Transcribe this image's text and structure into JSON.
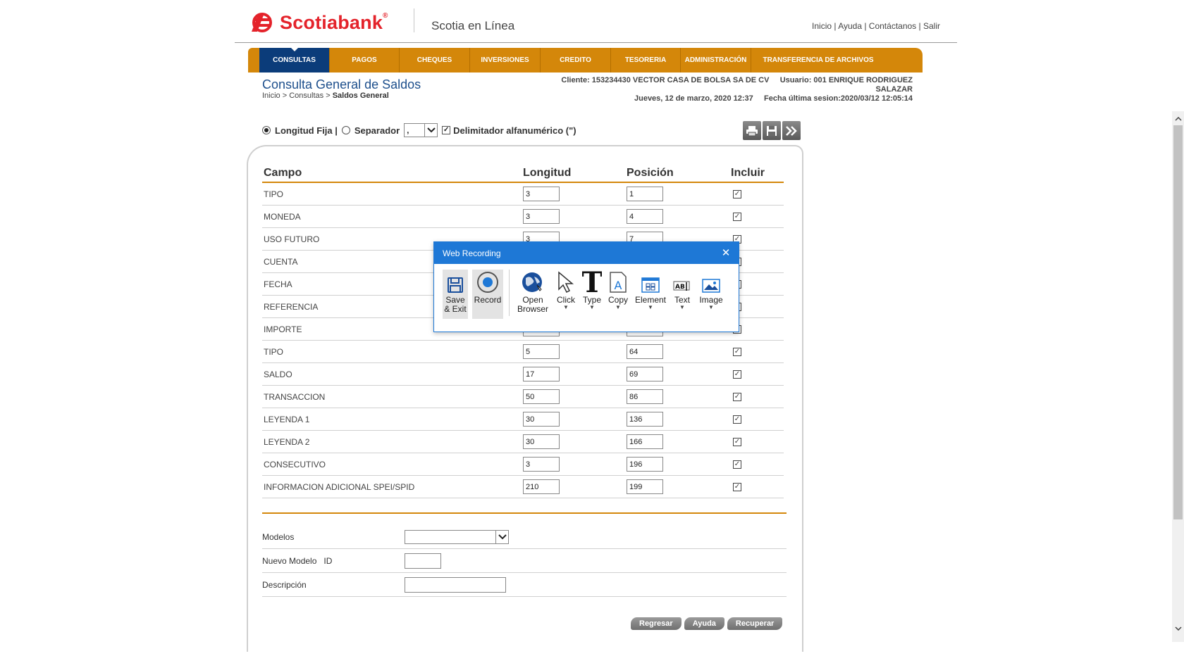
{
  "header": {
    "logo_text": "Scotiabank",
    "product": "Scotia en Línea",
    "links": [
      "Inicio",
      "Ayuda",
      "Contáctanos",
      "Salir"
    ]
  },
  "nav": [
    {
      "label": "CONSULTAS",
      "active": true
    },
    {
      "label": "PAGOS"
    },
    {
      "label": "CHEQUES"
    },
    {
      "label": "INVERSIONES"
    },
    {
      "label": "CREDITO"
    },
    {
      "label": "TESORERIA"
    },
    {
      "label": "ADMINISTRACIÓN"
    },
    {
      "label": "TRANSFERENCIA DE ARCHIVOS"
    }
  ],
  "page": {
    "title": "Consulta General de Saldos",
    "breadcrumb_1": "Inicio",
    "breadcrumb_2": "Consultas",
    "breadcrumb_current": "Saldos General",
    "client": "Cliente: 153234430 VECTOR CASA DE BOLSA SA DE CV",
    "user": "Usuario: 001 ENRIQUE RODRIGUEZ",
    "user_line2": "SALAZAR",
    "date": "Jueves, 12 de marzo, 2020 12:37",
    "last_session": "Fecha última sesion:2020/03/12 12:05:14"
  },
  "options": {
    "fixed_length": "Longitud Fija |",
    "separator": "Separador",
    "separator_value": ",",
    "delimiter": "Delimitador alfanumérico (\")"
  },
  "table": {
    "headers": [
      "Campo",
      "Longitud",
      "Posición",
      "Incluir"
    ],
    "rows": [
      {
        "campo": "TIPO",
        "longitud": "3",
        "posicion": "1"
      },
      {
        "campo": "MONEDA",
        "longitud": "3",
        "posicion": "4"
      },
      {
        "campo": "USO FUTURO",
        "longitud": "3",
        "posicion": "7"
      },
      {
        "campo": "CUENTA",
        "longitud": "",
        "posicion": ""
      },
      {
        "campo": "FECHA",
        "longitud": "",
        "posicion": ""
      },
      {
        "campo": "REFERENCIA",
        "longitud": "",
        "posicion": ""
      },
      {
        "campo": "IMPORTE",
        "longitud": "",
        "posicion": ""
      },
      {
        "campo": "TIPO",
        "longitud": "5",
        "posicion": "64"
      },
      {
        "campo": "SALDO",
        "longitud": "17",
        "posicion": "69"
      },
      {
        "campo": "TRANSACCION",
        "longitud": "50",
        "posicion": "86"
      },
      {
        "campo": "LEYENDA 1",
        "longitud": "30",
        "posicion": "136"
      },
      {
        "campo": "LEYENDA 2",
        "longitud": "30",
        "posicion": "166"
      },
      {
        "campo": "CONSECUTIVO",
        "longitud": "3",
        "posicion": "196"
      },
      {
        "campo": "INFORMACION ADICIONAL SPEI/SPID",
        "longitud": "210",
        "posicion": "199"
      }
    ]
  },
  "form": {
    "modelos": "Modelos",
    "nuevo_modelo": "Nuevo Modelo   ID",
    "descripcion": "Descripción"
  },
  "buttons": {
    "regresar": "Regresar",
    "ayuda": "Ayuda",
    "recuperar": "Recuperar"
  },
  "dialog": {
    "title": "Web Recording",
    "tools": [
      {
        "label": "Save\n& Exit",
        "icon": "floppy-icon"
      },
      {
        "label": "Record",
        "icon": "record-icon"
      },
      {
        "label": "Open\nBrowser",
        "icon": "globe-icon"
      },
      {
        "label": "Click",
        "icon": "cursor-icon"
      },
      {
        "label": "Type",
        "icon": "type-icon"
      },
      {
        "label": "Copy",
        "icon": "copy-icon"
      },
      {
        "label": "Element",
        "icon": "element-icon"
      },
      {
        "label": "Text",
        "icon": "text-icon"
      },
      {
        "label": "Image",
        "icon": "image-icon"
      }
    ]
  },
  "colors": {
    "brand_red": "#e4232b",
    "nav_orange": "#d4870a",
    "nav_active": "#0b3c7a",
    "title_blue": "#1d4f8c",
    "dialog_blue": "#1e78d6"
  }
}
